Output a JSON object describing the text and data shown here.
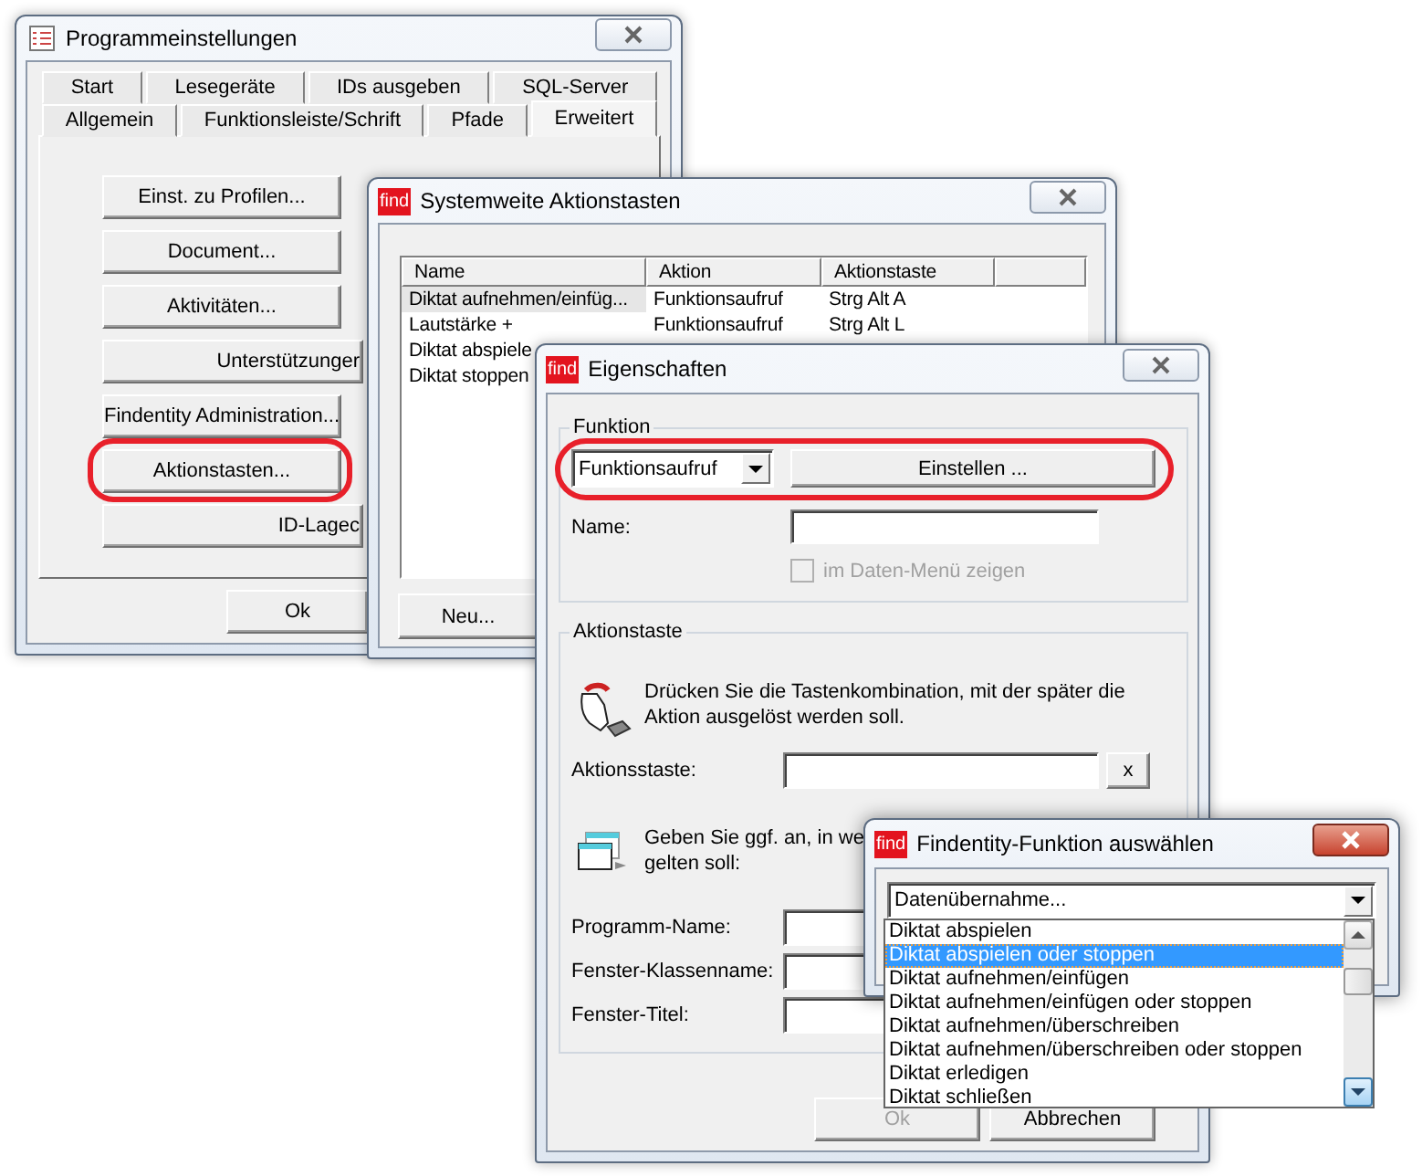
{
  "settings": {
    "title": "Programmeinstellungen",
    "tabs_row_1": [
      {
        "label": "Start",
        "selected": false
      },
      {
        "label": "Lesegeräte",
        "selected": false
      },
      {
        "label": "IDs ausgeben",
        "selected": false
      },
      {
        "label": "SQL-Server",
        "selected": false
      }
    ],
    "tabs_row_2": [
      {
        "label": "Allgemein",
        "selected": false
      },
      {
        "label": "Funktionsleiste/Schrift",
        "selected": false
      },
      {
        "label": "Pfade",
        "selected": false
      },
      {
        "label": "Erweitert",
        "selected": true
      }
    ],
    "buttons": [
      {
        "label": "Einst. zu Profilen...",
        "kind": "narrow",
        "highlighted": false
      },
      {
        "label": "Document...",
        "kind": "narrow",
        "highlighted": false
      },
      {
        "label": "Aktivitäten...",
        "kind": "narrow",
        "highlighted": false
      },
      {
        "label": "Unterstützunger",
        "kind": "wide",
        "highlighted": false
      },
      {
        "label": "Findentity Administration...",
        "kind": "narrow",
        "highlighted": false
      },
      {
        "label": "Aktionstasten...",
        "kind": "narrow",
        "highlighted": true
      },
      {
        "label": "ID-Lagec",
        "kind": "wide",
        "highlighted": false
      }
    ],
    "ok_button": "Ok"
  },
  "hotkeys": {
    "logo": "find",
    "title": "Systemweite Aktionstasten",
    "columns": [
      "Name",
      "Aktion",
      "Aktionstaste"
    ],
    "rows": [
      {
        "cells": [
          "Diktat aufnehmen/einfüg...",
          "Funktionsaufruf",
          "Strg Alt A"
        ],
        "selected": true
      },
      {
        "cells": [
          "Lautstärke +",
          "Funktionsaufruf",
          "Strg Alt L"
        ],
        "selected": false
      },
      {
        "cells": [
          "Diktat abspiele"
        ],
        "selected": false
      },
      {
        "cells": [
          "Diktat stoppen"
        ],
        "selected": false
      }
    ],
    "new_button": "Neu..."
  },
  "properties": {
    "logo": "find",
    "title": "Eigenschaften",
    "function_group": {
      "title": "Funktion",
      "highlighted": true,
      "function_value": "Funktionsaufruf",
      "settings_button": "Einstellen ...",
      "name_label": "Name:",
      "menu_checkbox": {
        "label": "im Daten-Menü zeigen",
        "checked": false,
        "disabled": true
      }
    },
    "hotkey_group": {
      "title": "Aktionstaste",
      "hint": "Drücken Sie die Tastenkombination, mit der später die Aktion ausgelöst werden soll.",
      "key_label": "Aktionsstaste:",
      "clear_button": "x",
      "window_hint_lines": [
        "Geben Sie ggf. an, in we",
        "gelten soll:"
      ],
      "window_fields": [
        "Programm-Name:",
        "Fenster-Klassenname:",
        "Fenster-Titel:"
      ]
    },
    "buttons": [
      {
        "label": "Ok",
        "disabled": true
      },
      {
        "label": "Abbrechen",
        "disabled": false
      }
    ]
  },
  "function_picker": {
    "logo": "find",
    "title": "Findentity-Funktion auswählen",
    "category_value": "Datenübernahme...",
    "options": [
      {
        "label": "Diktat abspielen",
        "selected": false
      },
      {
        "label": "Diktat abspielen oder stoppen",
        "selected": true
      },
      {
        "label": "Diktat aufnehmen/einfügen",
        "selected": false
      },
      {
        "label": "Diktat aufnehmen/einfügen oder stoppen",
        "selected": false
      },
      {
        "label": "Diktat aufnehmen/überschreiben",
        "selected": false
      },
      {
        "label": "Diktat aufnehmen/überschreiben oder stoppen",
        "selected": false
      },
      {
        "label": "Diktat erledigen",
        "selected": false
      },
      {
        "label": "Diktat schließen",
        "selected": false
      }
    ]
  }
}
